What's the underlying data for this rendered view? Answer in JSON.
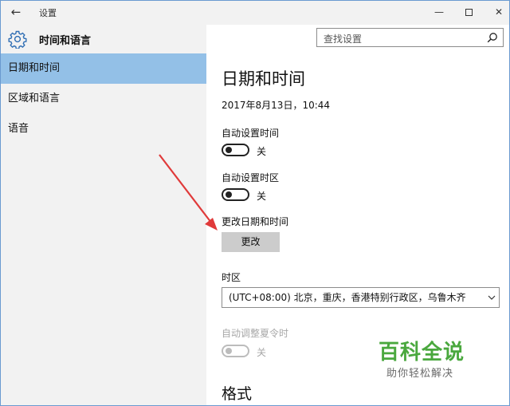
{
  "titlebar": {
    "back_glyph": "←",
    "title": "设置",
    "minimize_glyph": "—",
    "close_glyph": "✕"
  },
  "sidebar": {
    "section_title": "时间和语言",
    "items": [
      {
        "label": "日期和时间",
        "active": true
      },
      {
        "label": "区域和语言",
        "active": false
      },
      {
        "label": "语音",
        "active": false
      }
    ]
  },
  "search": {
    "placeholder": "查找设置"
  },
  "main": {
    "title": "日期和时间",
    "current_datetime": "2017年8月13日，10:44",
    "auto_time": {
      "label": "自动设置时间",
      "state": "关"
    },
    "auto_timezone": {
      "label": "自动设置时区",
      "state": "关"
    },
    "change_datetime": {
      "label": "更改日期和时间",
      "button": "更改"
    },
    "timezone": {
      "label": "时区",
      "value": "(UTC+08:00) 北京，重庆，香港特别行政区，乌鲁木齐"
    },
    "dst": {
      "label": "自动调整夏令时",
      "state": "关",
      "disabled": true
    },
    "format_title": "格式"
  },
  "watermark": {
    "main": "百科全说",
    "sub": "助你轻松解决"
  },
  "colors": {
    "active_item": "#93c0e7",
    "sidebar_bg": "#f2f2f2",
    "button_bg": "#cccccc",
    "annotation_arrow": "#e03a3a",
    "watermark_green": "#4aa83e"
  }
}
